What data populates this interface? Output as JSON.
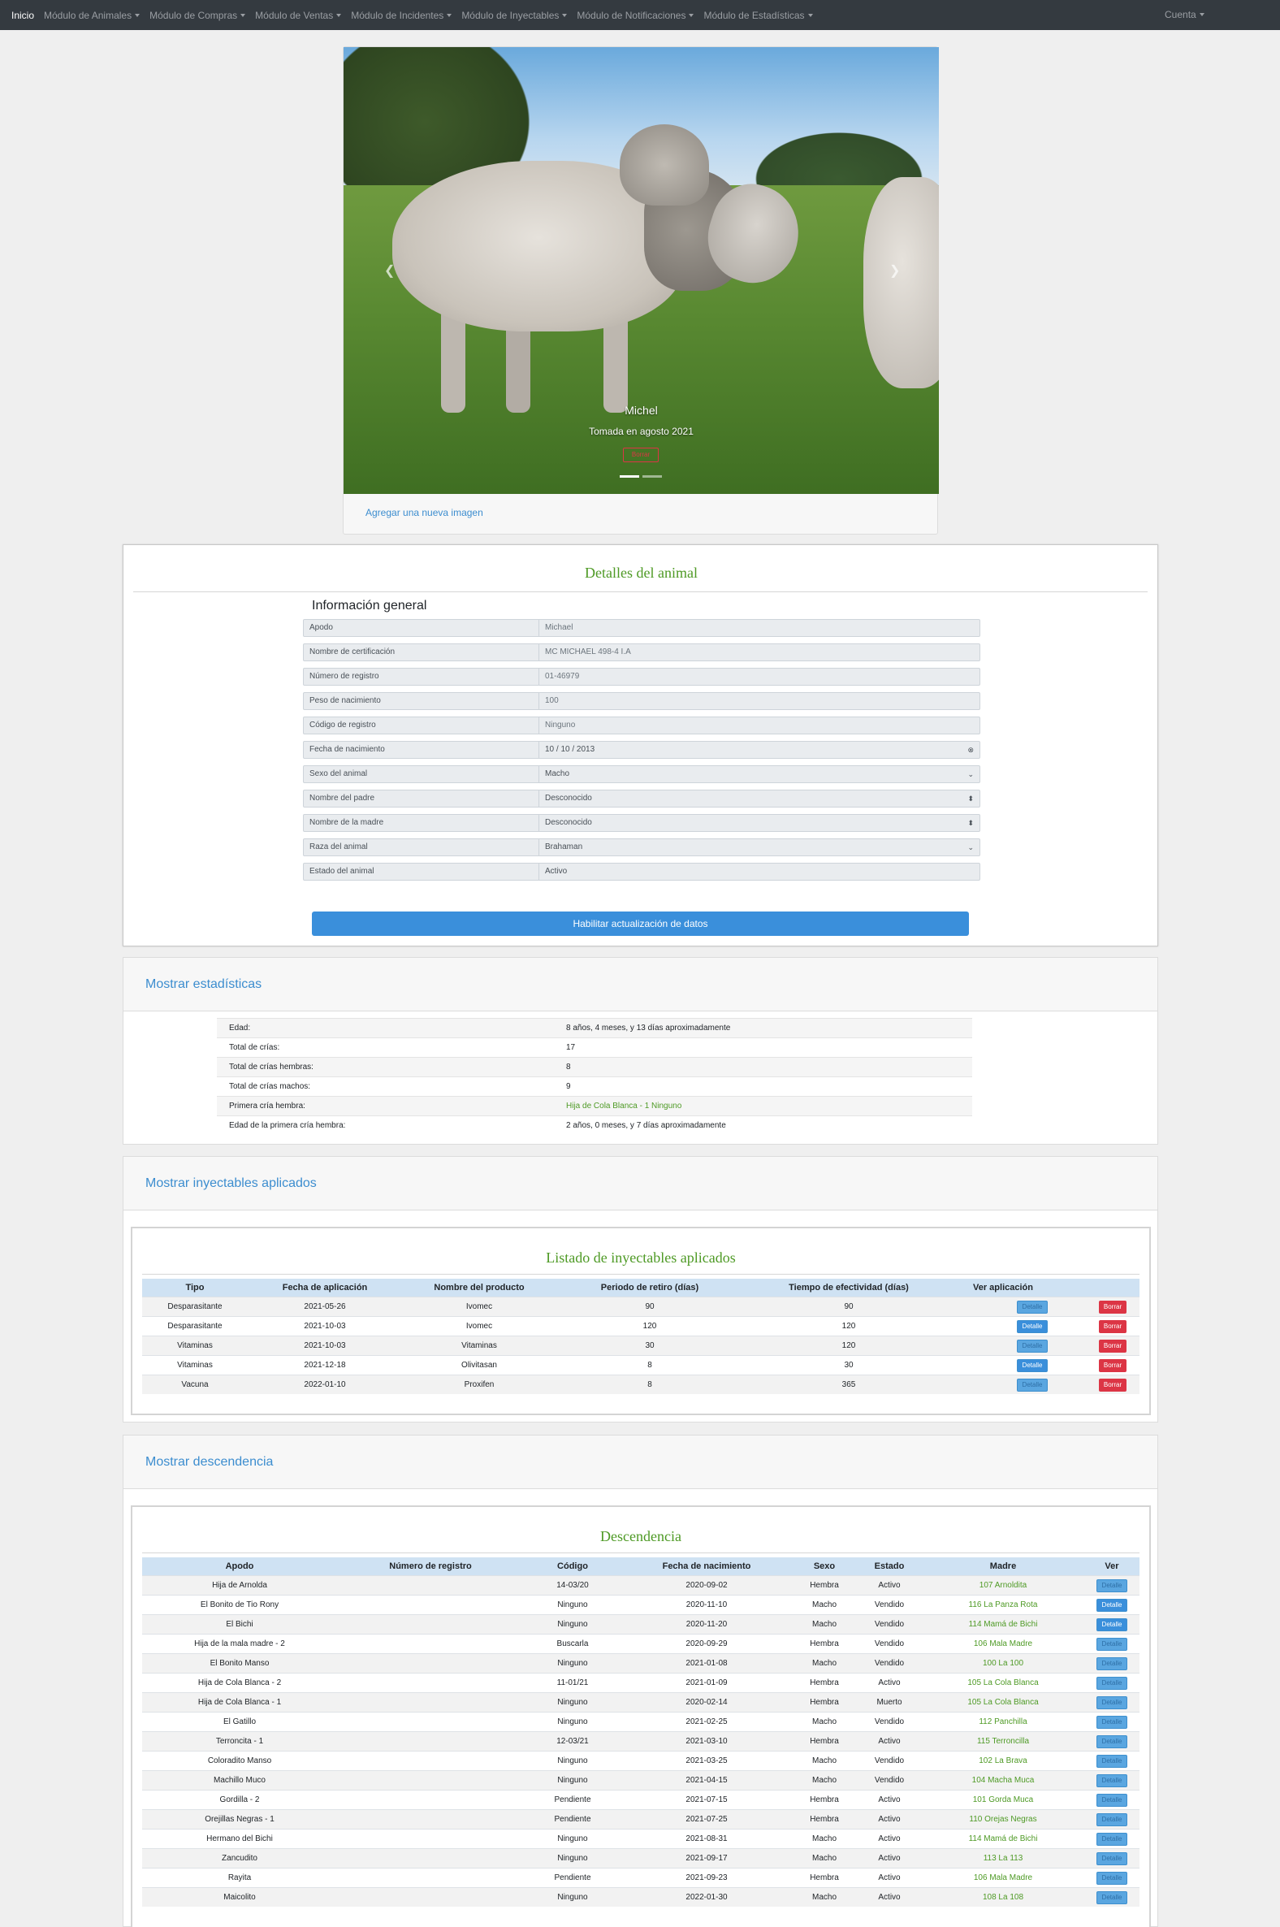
{
  "navbar": {
    "items": [
      {
        "label": "Inicio",
        "dropdown": false
      },
      {
        "label": "Módulo de Animales",
        "dropdown": true
      },
      {
        "label": "Módulo de Compras",
        "dropdown": true
      },
      {
        "label": "Módulo de Ventas",
        "dropdown": true
      },
      {
        "label": "Módulo de Incidentes",
        "dropdown": true
      },
      {
        "label": "Módulo de Inyectables",
        "dropdown": true
      },
      {
        "label": "Módulo de Notificaciones",
        "dropdown": true
      },
      {
        "label": "Módulo de Estadísticas",
        "dropdown": true
      }
    ],
    "account": "Cuenta"
  },
  "carousel": {
    "caption_title": "Michel",
    "caption_sub": "Tomada en agosto 2021",
    "delete_label": "Borrar",
    "prev_icon": "chevron-left-icon",
    "next_icon": "chevron-right-icon",
    "add_image": "Agregar una nueva imagen"
  },
  "details": {
    "title": "Detalles del animal",
    "heading": "Información general",
    "fields": [
      {
        "label": "Apodo",
        "value": "Michael"
      },
      {
        "label": "Nombre de certificación",
        "value": "MC MICHAEL 498-4 I.A"
      },
      {
        "label": "Número de registro",
        "value": "01-46979"
      },
      {
        "label": "Peso de nacimiento",
        "value": "100"
      },
      {
        "label": "Código de registro",
        "value": "Ninguno"
      },
      {
        "label": "Fecha de nacimiento",
        "value": "10 / 10 / 2013"
      },
      {
        "label": "Sexo del animal",
        "value": "Macho"
      },
      {
        "label": "Nombre del padre",
        "value": "Desconocido"
      },
      {
        "label": "Nombre de la madre",
        "value": "Desconocido"
      },
      {
        "label": "Raza del animal",
        "value": "Brahaman"
      },
      {
        "label": "Estado del animal",
        "value": "Activo"
      }
    ],
    "update_button": "Habilitar actualización de datos"
  },
  "stats": {
    "header": "Mostrar estadísticas",
    "rows": [
      {
        "label": "Edad:",
        "value": "8 años, 4 meses, y 13 días aproximadamente"
      },
      {
        "label": "Total de crías:",
        "value": "17"
      },
      {
        "label": "Total de crías hembras:",
        "value": "8"
      },
      {
        "label": "Total de crías machos:",
        "value": "9"
      },
      {
        "label": "Primera cría hembra:",
        "value": "Hija de Cola Blanca - 1 Ninguno"
      },
      {
        "label": "Edad de la primera cría hembra:",
        "value": "2 años, 0 meses, y 7 días aproximadamente"
      }
    ]
  },
  "injectables": {
    "header": "Mostrar inyectables aplicados",
    "title": "Listado de inyectables aplicados",
    "columns": [
      "Tipo",
      "Fecha de aplicación",
      "Nombre del producto",
      "Periodo de retiro (días)",
      "Tiempo de efectividad (días)",
      "Ver aplicación"
    ],
    "detail_label": "Detalle",
    "delete_label": "Borrar",
    "rows": [
      [
        "Desparasitante",
        "2021-05-26",
        "Ivomec",
        "90",
        "90"
      ],
      [
        "Desparasitante",
        "2021-10-03",
        "Ivomec",
        "120",
        "120"
      ],
      [
        "Vitaminas",
        "2021-10-03",
        "Vitaminas",
        "30",
        "120"
      ],
      [
        "Vitaminas",
        "2021-12-18",
        "Olivitasan",
        "8",
        "30"
      ],
      [
        "Vacuna",
        "2022-01-10",
        "Proxifen",
        "8",
        "365"
      ]
    ]
  },
  "offspring": {
    "header": "Mostrar descendencia",
    "title": "Descendencia",
    "columns": [
      "Apodo",
      "Número de registro",
      "Código",
      "Fecha de nacimiento",
      "Sexo",
      "Estado",
      "Madre",
      "Ver"
    ],
    "detail_label": "Detalle",
    "rows": [
      [
        "Hija de Arnolda",
        "",
        "14-03/20",
        "2020-09-02",
        "Hembra",
        "Activo",
        "107 Arnoldita"
      ],
      [
        "El Bonito de Tio Rony",
        "",
        "Ninguno",
        "2020-11-10",
        "Macho",
        "Vendido",
        "116 La Panza Rota"
      ],
      [
        "El Bichi",
        "",
        "Ninguno",
        "2020-11-20",
        "Macho",
        "Vendido",
        "114 Mamá de Bichi"
      ],
      [
        "Hija de la mala madre - 2",
        "",
        "Buscarla",
        "2020-09-29",
        "Hembra",
        "Vendido",
        "106 Mala Madre"
      ],
      [
        "El Bonito Manso",
        "",
        "Ninguno",
        "2021-01-08",
        "Macho",
        "Vendido",
        "100 La 100"
      ],
      [
        "Hija de Cola Blanca - 2",
        "",
        "11-01/21",
        "2021-01-09",
        "Hembra",
        "Activo",
        "105 La Cola Blanca"
      ],
      [
        "Hija de Cola Blanca - 1",
        "",
        "Ninguno",
        "2020-02-14",
        "Hembra",
        "Muerto",
        "105 La Cola Blanca"
      ],
      [
        "El Gatillo",
        "",
        "Ninguno",
        "2021-02-25",
        "Macho",
        "Vendido",
        "112 Panchilla"
      ],
      [
        "Terroncita - 1",
        "",
        "12-03/21",
        "2021-03-10",
        "Hembra",
        "Activo",
        "115 Terroncilla"
      ],
      [
        "Coloradito Manso",
        "",
        "Ninguno",
        "2021-03-25",
        "Macho",
        "Vendido",
        "102 La Brava"
      ],
      [
        "Machillo Muco",
        "",
        "Ninguno",
        "2021-04-15",
        "Macho",
        "Vendido",
        "104 Macha Muca"
      ],
      [
        "Gordilla - 2",
        "",
        "Pendiente",
        "2021-07-15",
        "Hembra",
        "Activo",
        "101 Gorda Muca"
      ],
      [
        "Orejillas Negras - 1",
        "",
        "Pendiente",
        "2021-07-25",
        "Hembra",
        "Activo",
        "110 Orejas Negras"
      ],
      [
        "Hermano del Bichi",
        "",
        "Ninguno",
        "2021-08-31",
        "Macho",
        "Activo",
        "114 Mamá de Bichi"
      ],
      [
        "Zancudito",
        "",
        "Ninguno",
        "2021-09-17",
        "Macho",
        "Activo",
        "113 La 113"
      ],
      [
        "Rayita",
        "",
        "Pendiente",
        "2021-09-23",
        "Hembra",
        "Activo",
        "106 Mala Madre"
      ],
      [
        "Maicolito",
        "",
        "Ninguno",
        "2022-01-30",
        "Macho",
        "Activo",
        "108 La 108"
      ]
    ]
  },
  "colors": {
    "navbar": "#343a40",
    "accent_green": "#4e9a25",
    "link_blue": "#3c8dcf",
    "danger": "#dc3545",
    "table_head": "#cfe2f3"
  }
}
